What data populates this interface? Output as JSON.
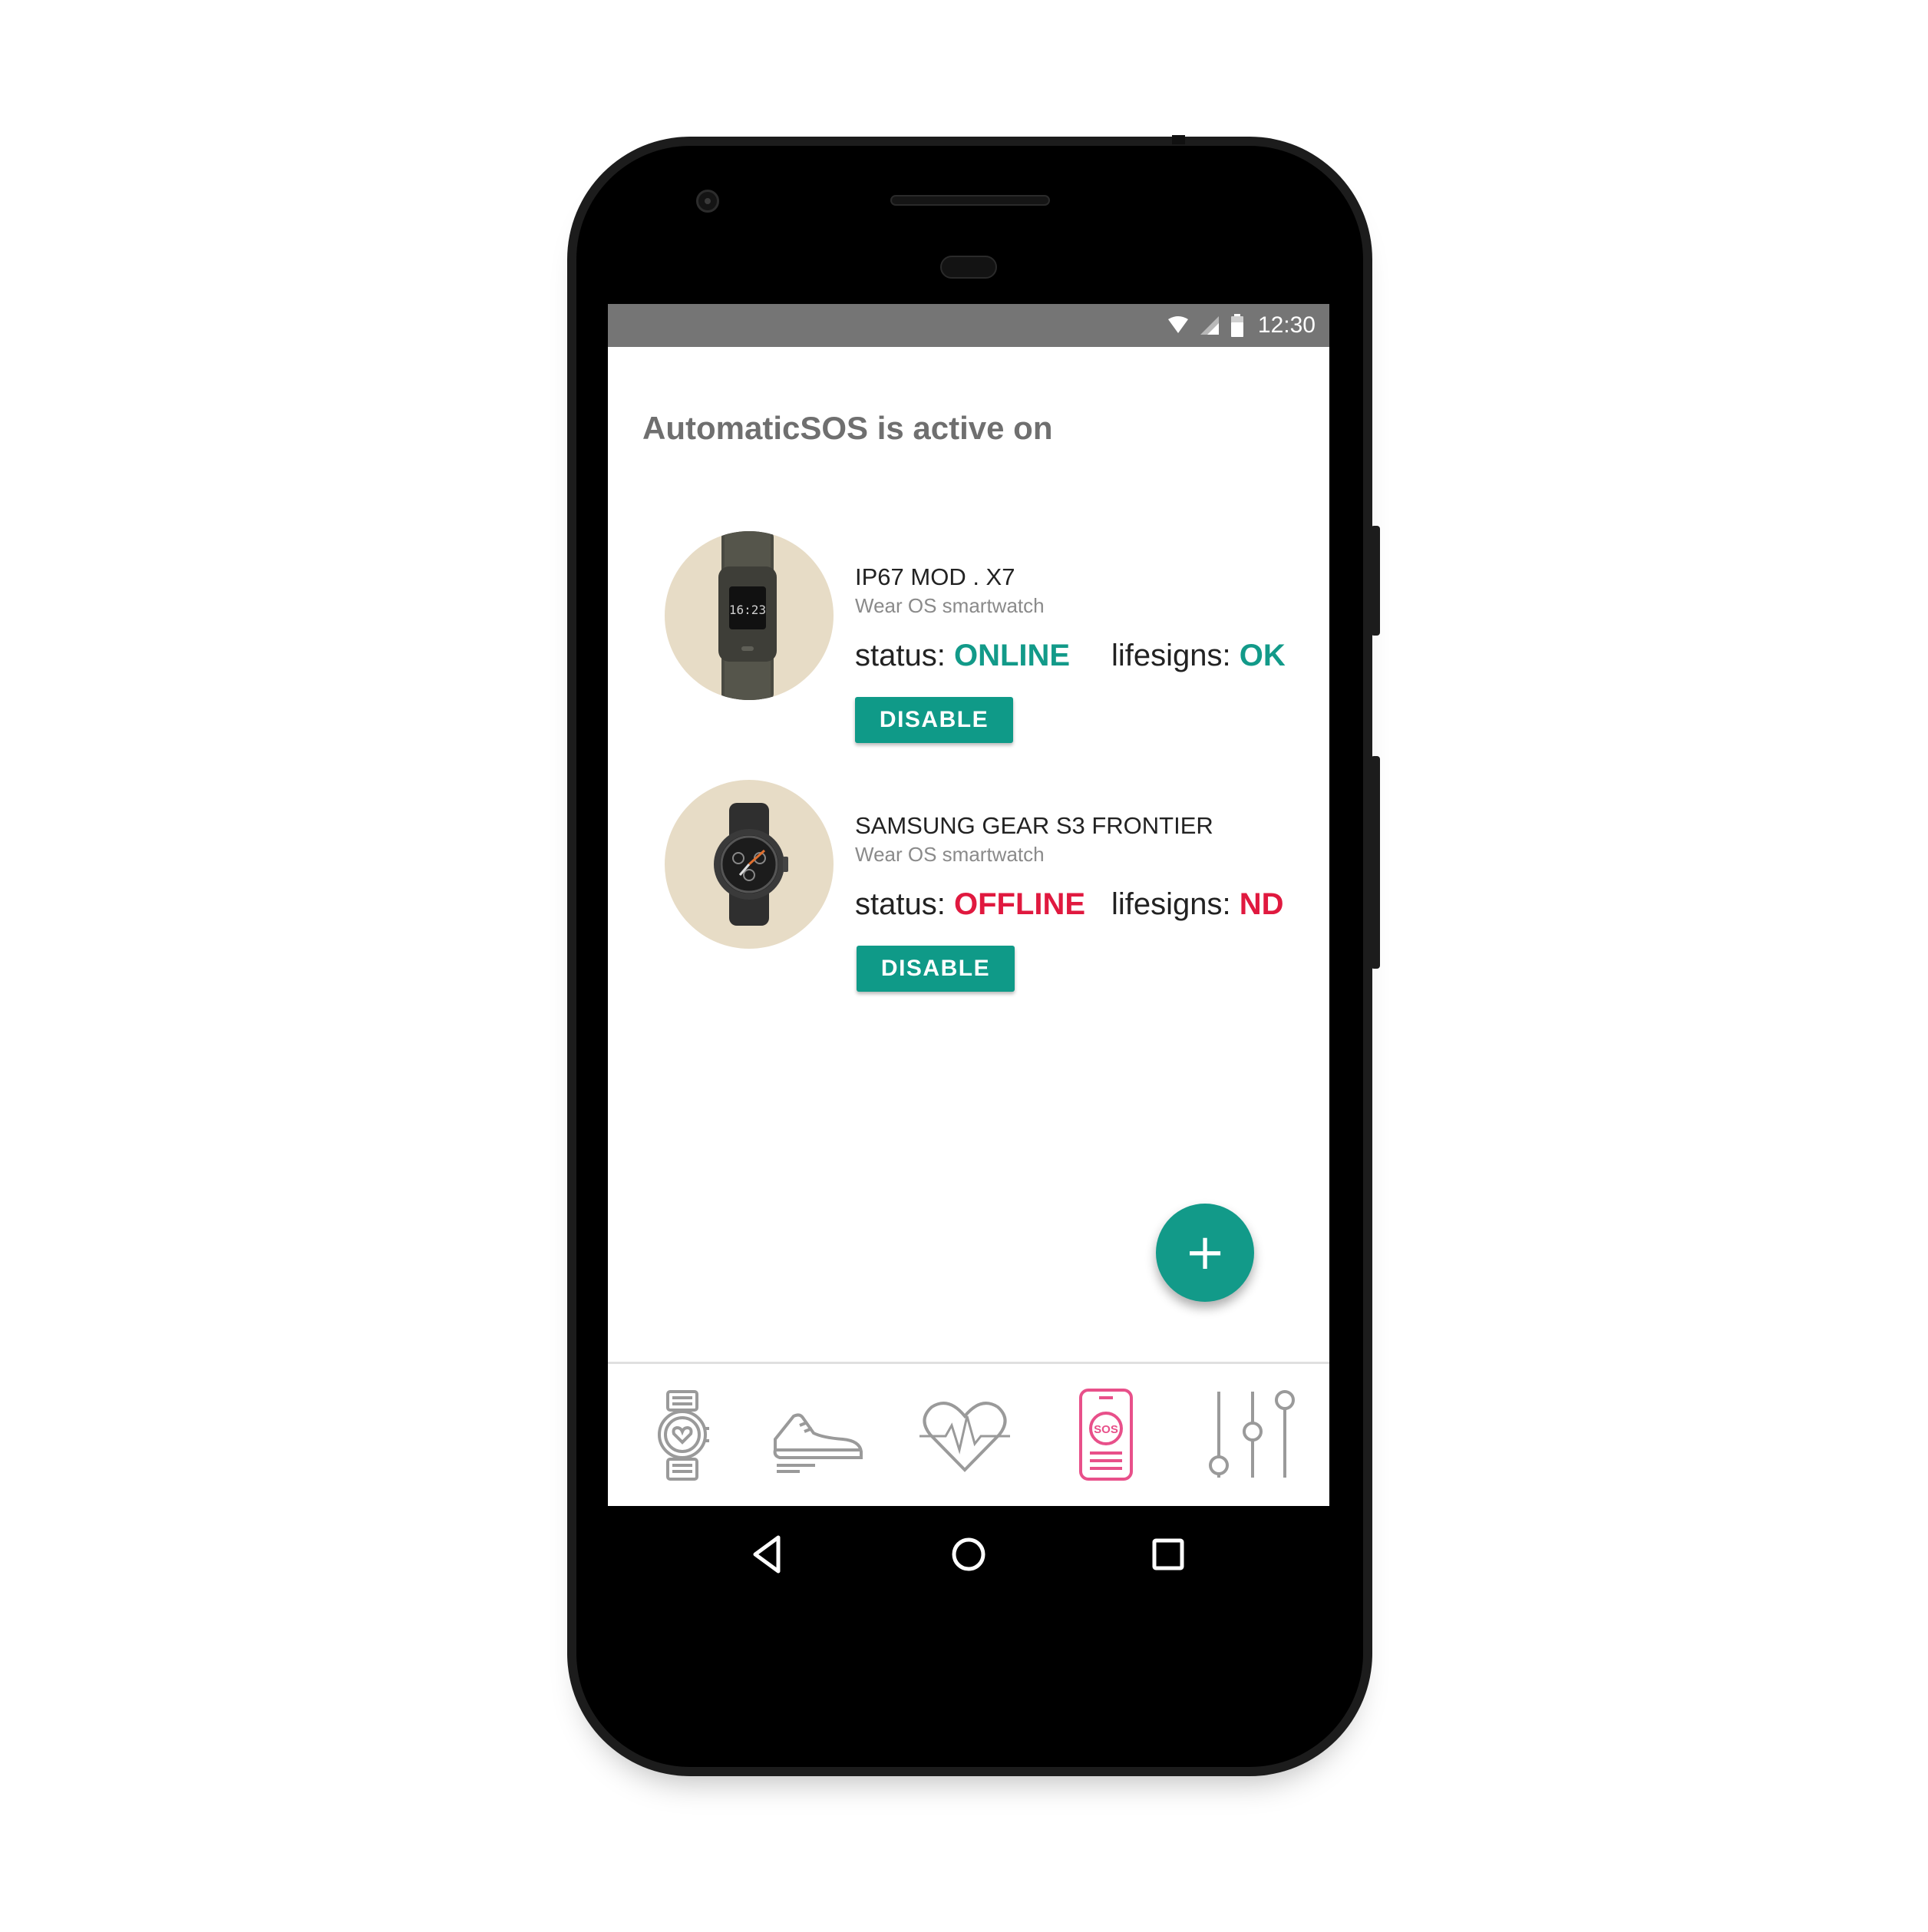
{
  "statusbar": {
    "time": "12:30",
    "icons": [
      "wifi-icon",
      "signal-icon",
      "battery-icon"
    ]
  },
  "page": {
    "title": "AutomaticSOS is active on"
  },
  "devices": [
    {
      "name": "IP67 MOD . X7",
      "type": "Wear OS smartwatch",
      "status_label": "status:",
      "status_value": "ONLINE",
      "lifesigns_label": "lifesigns:",
      "lifesigns_value": "OK",
      "button_label": "DISABLE",
      "state_color": "#129a89",
      "watch_display": "16:23"
    },
    {
      "name": "SAMSUNG GEAR S3 FRONTIER",
      "type": "Wear OS smartwatch",
      "status_label": "status:",
      "status_value": "OFFLINE",
      "lifesigns_label": "lifesigns:",
      "lifesigns_value": "ND",
      "button_label": "DISABLE",
      "state_color": "#e0193f"
    }
  ],
  "fab": {
    "label": "+"
  },
  "bottom_nav": {
    "items": [
      {
        "icon": "smartwatch-heart-icon",
        "active": false
      },
      {
        "icon": "sneaker-icon",
        "active": false
      },
      {
        "icon": "heartbeat-icon",
        "active": false
      },
      {
        "icon": "sos-phone-icon",
        "active": true,
        "label": "SOS"
      },
      {
        "icon": "sliders-icon",
        "active": false
      }
    ],
    "active_color": "#e8508a",
    "inactive_color": "#9a9a9a"
  },
  "system_nav": [
    "back-icon",
    "home-icon",
    "recents-icon"
  ]
}
